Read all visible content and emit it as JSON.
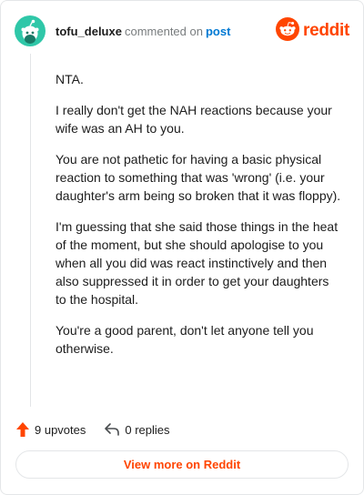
{
  "comment": {
    "username": "tofu_deluxe",
    "verb": "commented on",
    "target": "post",
    "paragraphs": [
      "NTA.",
      "I really don't get the NAH reactions because your wife was an AH to you.",
      "You are not pathetic for having a basic physical reaction to something that was 'wrong' (i.e. your daughter's arm being so broken that it was floppy).",
      "I'm guessing that she said those things in the heat of the moment, but she should apologise to you when all you did was react instinctively and then also suppressed it in order to get your daughters to the hospital.",
      "You're a good parent, don't let anyone tell you otherwise."
    ]
  },
  "brand": {
    "wordmark": "reddit",
    "color": "#ff4500"
  },
  "avatar": {
    "color": "#2fc7a8",
    "icon": "snoo-avatar-icon"
  },
  "actions": {
    "upvotes": "9 upvotes",
    "replies": "0 replies",
    "upvote_icon": "upvote-arrow-icon",
    "reply_icon": "reply-arrow-icon",
    "upvote_color": "#ff4500"
  },
  "footer": {
    "view_more": "View more on Reddit"
  }
}
